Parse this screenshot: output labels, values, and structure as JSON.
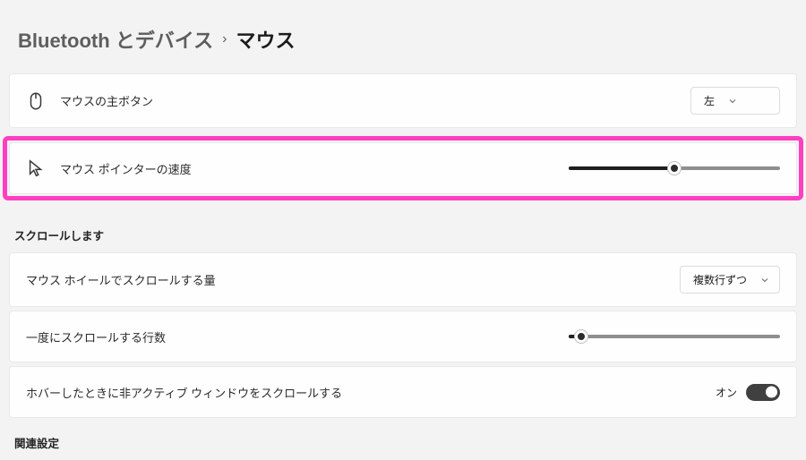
{
  "breadcrumb": {
    "parent": "Bluetooth とデバイス",
    "separator": "›",
    "current": "マウス"
  },
  "rows": {
    "primary_button": {
      "label": "マウスの主ボタン",
      "value": "左"
    },
    "pointer_speed": {
      "label": "マウス ポインターの速度",
      "value_percent": 50
    },
    "scroll_amount": {
      "label": "マウス ホイールでスクロールする量",
      "value": "複数行ずつ"
    },
    "lines_at_once": {
      "label": "一度にスクロールする行数",
      "value_percent": 6
    },
    "inactive_hover": {
      "label": "ホバーしたときに非アクティブ ウィンドウをスクロールする",
      "state_label": "オン"
    }
  },
  "headings": {
    "scroll": "スクロールします",
    "related": "関連設定"
  }
}
